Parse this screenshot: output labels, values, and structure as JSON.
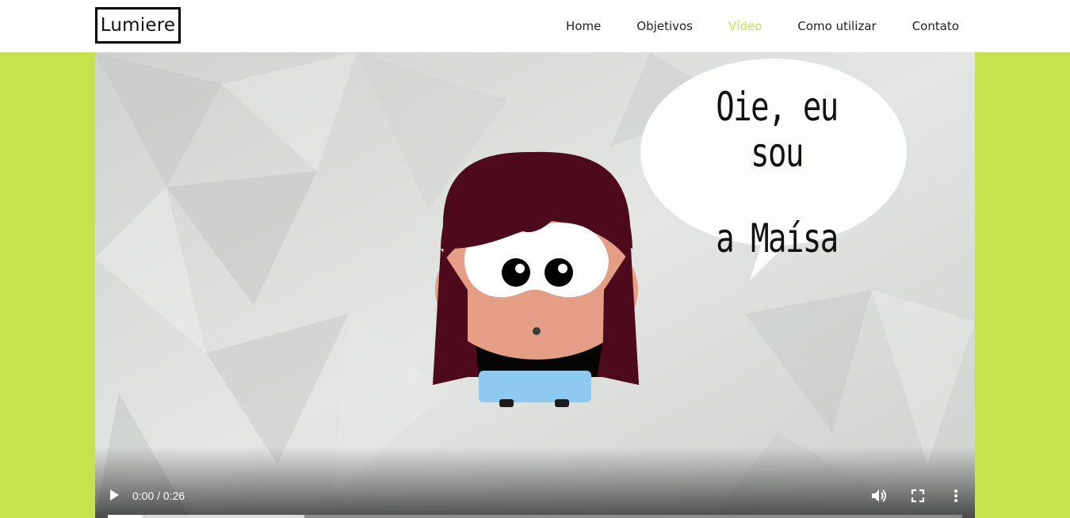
{
  "header": {
    "logo": "Lumiere",
    "nav": [
      {
        "label": "Home",
        "active": false
      },
      {
        "label": "Objetivos",
        "active": false
      },
      {
        "label": "Vídeo",
        "active": true
      },
      {
        "label": "Como utilizar",
        "active": false
      },
      {
        "label": "Contato",
        "active": false
      }
    ]
  },
  "video": {
    "speech_bubble": {
      "line1": "Oie, eu sou",
      "line2": "a Maísa"
    },
    "controls": {
      "play_icon": "play-icon",
      "time": "0:00 / 0:26",
      "volume_icon": "volume-icon",
      "fullscreen_icon": "fullscreen-icon",
      "more_icon": "more-options-icon",
      "played_fraction": 0.04,
      "buffered_fraction": 0.23
    }
  },
  "colors": {
    "accent": "#c4e34f",
    "nav_text": "#222222",
    "hair": "#4e0a1d",
    "skin": "#e39e85",
    "shirt": "#050505",
    "pants": "#8ecaf0"
  }
}
